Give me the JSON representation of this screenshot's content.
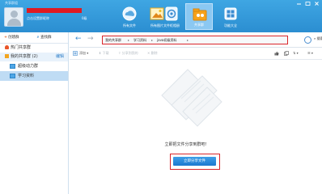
{
  "window": {
    "title": "共享群组"
  },
  "user": {
    "status": "点击设置群昵称",
    "level": "0级"
  },
  "toolbar": {
    "items": [
      {
        "label": "所有文件",
        "icon": "cloud-icon"
      },
      {
        "label": "所有图片",
        "icon": "photo-icon"
      },
      {
        "label": "文件柜相册",
        "icon": "cabinet-icon"
      },
      {
        "label": "共享群",
        "icon": "share-group-icon",
        "active": true
      },
      {
        "label": "功能大全",
        "icon": "apps-icon"
      }
    ]
  },
  "sidebar": {
    "create_label": "创建群",
    "find_label": "查找群",
    "hot_label": "热门共享群",
    "mine_label": "我的共享群 (2)",
    "edit_label": "编辑",
    "groups": [
      {
        "label": "超级动力群"
      },
      {
        "label": "学习资料"
      }
    ]
  },
  "breadcrumb": {
    "items": [
      "我的共享群",
      "学习资料",
      "java初级资料"
    ]
  },
  "nav": {
    "search_label": "搜索"
  },
  "actions": {
    "add": "添加",
    "download": "下载",
    "share": "分享到我的",
    "delete": "删除"
  },
  "empty": {
    "prompt": "立即把文件分享到群吧！",
    "button": "立即分享文件"
  },
  "colors": {
    "banner": "#2b8ed1",
    "highlight": "#d9252a",
    "button": "#1c78cf",
    "selected": "#bfdcf4"
  }
}
